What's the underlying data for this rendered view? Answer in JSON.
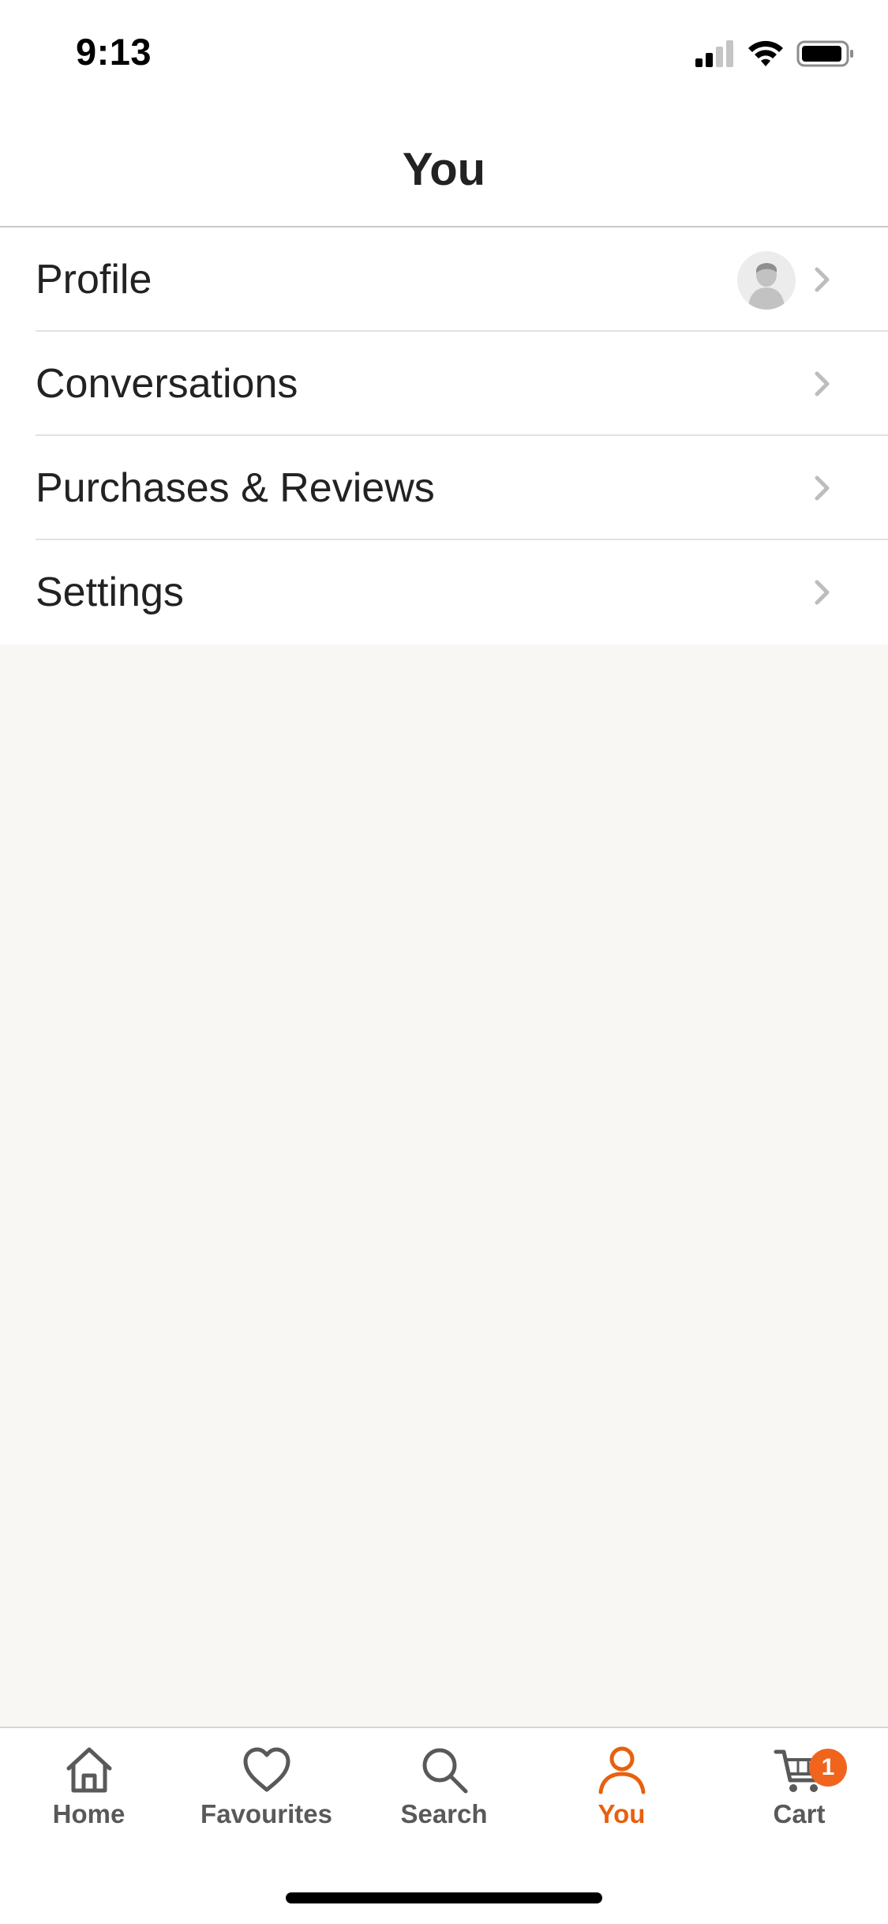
{
  "status_bar": {
    "time": "9:13"
  },
  "header": {
    "title": "You"
  },
  "menu": {
    "items": [
      {
        "label": "Profile"
      },
      {
        "label": "Conversations"
      },
      {
        "label": "Purchases & Reviews"
      },
      {
        "label": "Settings"
      }
    ]
  },
  "tab_bar": {
    "tabs": [
      {
        "label": "Home",
        "icon": "home-icon"
      },
      {
        "label": "Favourites",
        "icon": "heart-icon"
      },
      {
        "label": "Search",
        "icon": "search-icon"
      },
      {
        "label": "You",
        "icon": "person-icon",
        "active": true
      },
      {
        "label": "Cart",
        "icon": "cart-icon",
        "badge": "1"
      }
    ]
  },
  "colors": {
    "accent": "#e8600f",
    "badge": "#f1641e",
    "content_background": "#f8f7f4"
  }
}
